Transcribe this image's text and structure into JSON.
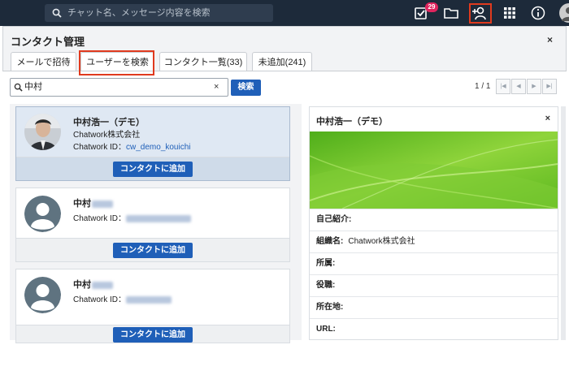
{
  "topbar": {
    "search_placeholder": "チャット名、メッセージ内容を検索",
    "task_badge": "29",
    "icons": [
      "task-icon",
      "folder-icon",
      "add-contact-icon",
      "apps-grid-icon",
      "info-icon"
    ]
  },
  "panel": {
    "title": "コンタクト管理",
    "close": "×",
    "tabs": [
      {
        "label": "メールで招待"
      },
      {
        "label": "ユーザーを検索"
      },
      {
        "label": "コンタクト一覧(33)"
      },
      {
        "label": "未追加(241)"
      }
    ],
    "active_tab": "ユーザーを検索"
  },
  "search": {
    "query": "中村",
    "clear": "×",
    "button": "検索"
  },
  "pager": {
    "text": "1 / 1",
    "buttons": [
      "|◀",
      "◀",
      "▶",
      "▶|"
    ]
  },
  "results": [
    {
      "name": "中村浩一（デモ）",
      "company": "Chatwork株式会社",
      "id_label": "Chatwork ID：",
      "id_value": "cw_demo_kouichi",
      "add_button": "コンタクトに追加",
      "selected": true
    },
    {
      "name": "中村",
      "company": "",
      "id_label": "Chatwork ID：",
      "id_value": "",
      "add_button": "コンタクトに追加",
      "selected": false
    },
    {
      "name": "中村",
      "company": "",
      "id_label": "Chatwork ID：",
      "id_value": "",
      "add_button": "コンタクトに追加",
      "selected": false
    }
  ],
  "detail": {
    "name": "中村浩一（デモ）",
    "close": "×",
    "fields": [
      {
        "label": "自己紹介:",
        "value": ""
      },
      {
        "label": "組織名:",
        "value": "Chatwork株式会社"
      },
      {
        "label": "所属:",
        "value": ""
      },
      {
        "label": "役職:",
        "value": ""
      },
      {
        "label": "所在地:",
        "value": ""
      },
      {
        "label": "URL:",
        "value": ""
      }
    ]
  },
  "colors": {
    "topbar": "#1d2a3a",
    "primary_button": "#1f5fb8",
    "highlight_box": "#e03a1e",
    "badge": "#e0245e",
    "banner_green": "#6cc22a"
  }
}
